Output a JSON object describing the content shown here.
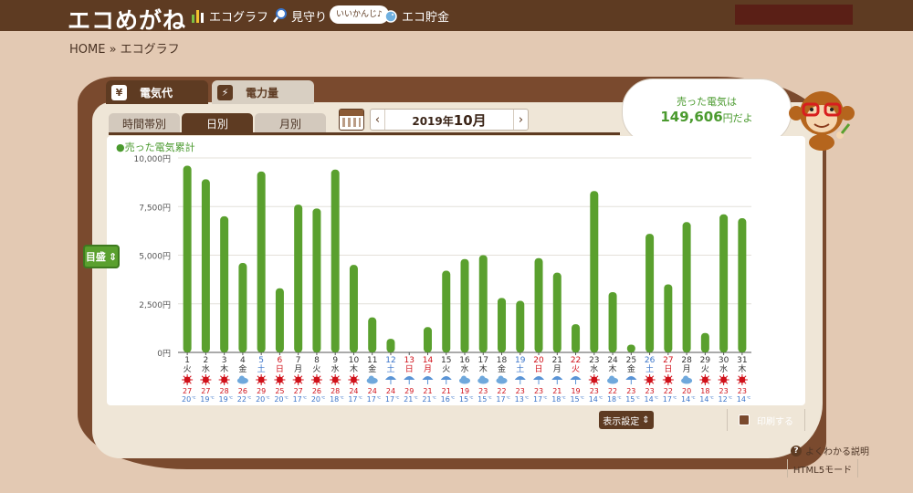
{
  "header": {
    "logo": "エコめがね",
    "nav": [
      {
        "label": "エコグラフ",
        "icon": "bar-graph-icon"
      },
      {
        "label": "見守り",
        "icon": "magnifier-icon"
      },
      {
        "label": "エコ貯金",
        "icon": "piggy-bank-icon"
      }
    ],
    "badge": "いいかんじ♪"
  },
  "breadcrumb": "HOME » エコグラフ",
  "type_tabs": {
    "cost": {
      "label": "電気代",
      "icon": "¥"
    },
    "power": {
      "label": "電力量",
      "icon": "⚡"
    }
  },
  "period_tabs": {
    "hour": "時間帯別",
    "day": "日別",
    "month": "月別"
  },
  "date_nav": {
    "year": "2019年",
    "month": "10月",
    "prev": "‹",
    "next": "›"
  },
  "bubble": {
    "line1": "売った電気は",
    "amount": "149,606",
    "unit": "円だよ"
  },
  "scale_button": "目盛",
  "display_settings": "表示設定",
  "print": "印刷する",
  "help": "よくわかる説明",
  "html5": "HTML5モード",
  "colors": {
    "bar": "#5aa02e",
    "brown": "#5e3b22",
    "sunday": "#d0121b",
    "saturday": "#3a74c9"
  },
  "chart_data": {
    "type": "bar",
    "legend": "●売った電気累計",
    "ylim": [
      0,
      10000
    ],
    "y_ticks": [
      "0円",
      "2,500円",
      "5,000円",
      "7,500円",
      "10,000円"
    ],
    "y_tick_values": [
      0,
      2500,
      5000,
      7500,
      10000
    ],
    "categories": [
      "1",
      "2",
      "3",
      "4",
      "5",
      "6",
      "7",
      "8",
      "9",
      "10",
      "11",
      "12",
      "13",
      "14",
      "15",
      "16",
      "17",
      "18",
      "19",
      "20",
      "21",
      "22",
      "23",
      "24",
      "25",
      "26",
      "27",
      "28",
      "29",
      "30",
      "31"
    ],
    "weekdays": [
      "火",
      "水",
      "木",
      "金",
      "土",
      "日",
      "月",
      "火",
      "水",
      "木",
      "金",
      "土",
      "日",
      "月",
      "火",
      "水",
      "木",
      "金",
      "土",
      "日",
      "月",
      "火",
      "水",
      "木",
      "金",
      "土",
      "日",
      "月",
      "火",
      "水",
      "木"
    ],
    "day_colors": [
      "",
      "",
      "",
      "",
      "sat",
      "sun",
      "",
      "",
      "",
      "",
      "",
      "sat",
      "sun",
      "sun",
      "",
      "",
      "",
      "",
      "sat",
      "sun",
      "",
      "sun",
      "",
      "",
      "",
      "sat",
      "sun",
      "",
      "",
      "",
      ""
    ],
    "values": [
      9600,
      8900,
      7000,
      4600,
      9300,
      3300,
      7600,
      7400,
      9400,
      4500,
      1800,
      700,
      0,
      1300,
      4200,
      4800,
      5000,
      2800,
      2650,
      4850,
      4100,
      1450,
      8300,
      3100,
      400,
      6100,
      3500,
      6700,
      1000,
      7100,
      6900
    ],
    "weather": [
      "sun",
      "sun",
      "sun",
      "cloud",
      "sun",
      "sun",
      "sun",
      "sun",
      "sun",
      "sun",
      "cloud",
      "umbrella",
      "umbrella",
      "umbrella",
      "umbrella",
      "cloud",
      "cloud",
      "cloud",
      "umbrella",
      "umbrella",
      "umbrella",
      "umbrella",
      "sun",
      "cloud",
      "umbrella",
      "sun",
      "sun",
      "cloud",
      "sun",
      "sun",
      "sun"
    ],
    "high_temps": [
      "27",
      "27",
      "28",
      "26",
      "29",
      "25",
      "27",
      "26",
      "28",
      "24",
      "24",
      "24",
      "29",
      "21",
      "21",
      "19",
      "23",
      "22",
      "23",
      "23",
      "21",
      "19",
      "23",
      "22",
      "23",
      "23",
      "22",
      "20",
      "18",
      "23",
      "23"
    ],
    "low_temps": [
      "20",
      "19",
      "19",
      "22",
      "20",
      "20",
      "17",
      "20",
      "18",
      "17",
      "17",
      "17",
      "21",
      "21",
      "16",
      "15",
      "15",
      "17",
      "13",
      "17",
      "18",
      "15",
      "14",
      "18",
      "15",
      "14",
      "17",
      "14",
      "14",
      "12",
      "14"
    ],
    "temp_unit": "℃"
  }
}
